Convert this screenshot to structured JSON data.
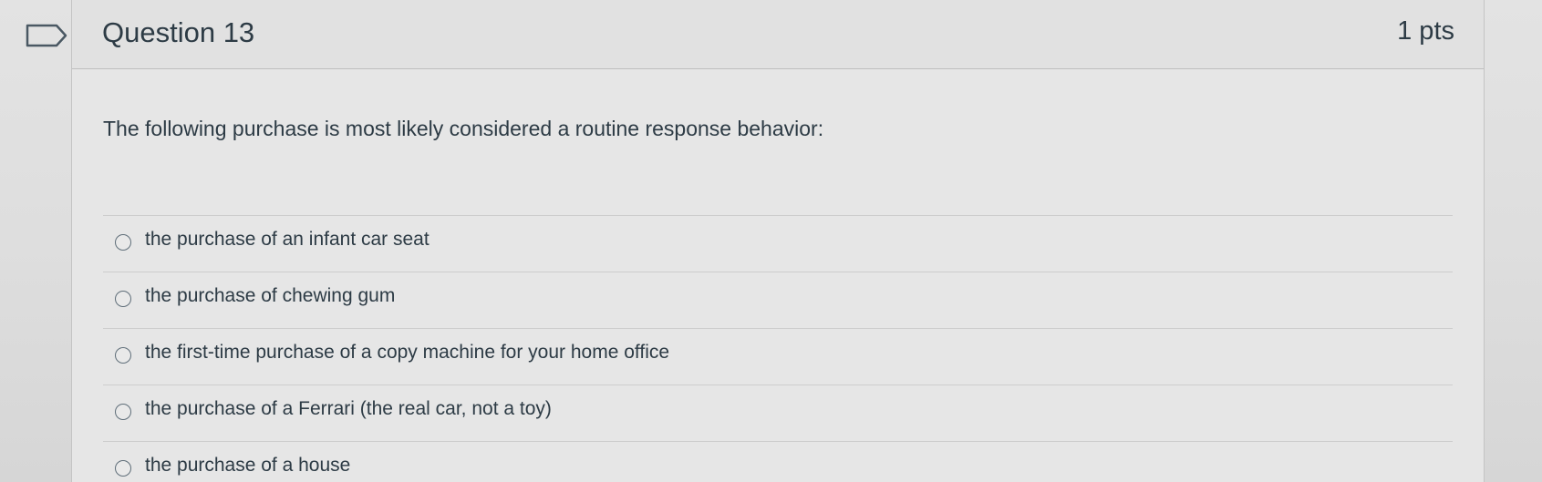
{
  "question": {
    "title": "Question 13",
    "points": "1 pts",
    "text": "The following purchase is most likely considered a routine response behavior:",
    "flag_icon": "flag-outline-icon"
  },
  "answers": [
    {
      "label": "the purchase of an infant car seat",
      "selected": false
    },
    {
      "label": "the purchase of chewing gum",
      "selected": false
    },
    {
      "label": "the first-time purchase of a copy machine for your home office",
      "selected": false
    },
    {
      "label": "the purchase of a Ferrari (the real car, not a toy)",
      "selected": false
    },
    {
      "label": "the purchase of a house",
      "selected": false
    }
  ],
  "colors": {
    "text": "#2d3b45",
    "border": "#c4c4c4",
    "background": "#e6e6e6"
  }
}
